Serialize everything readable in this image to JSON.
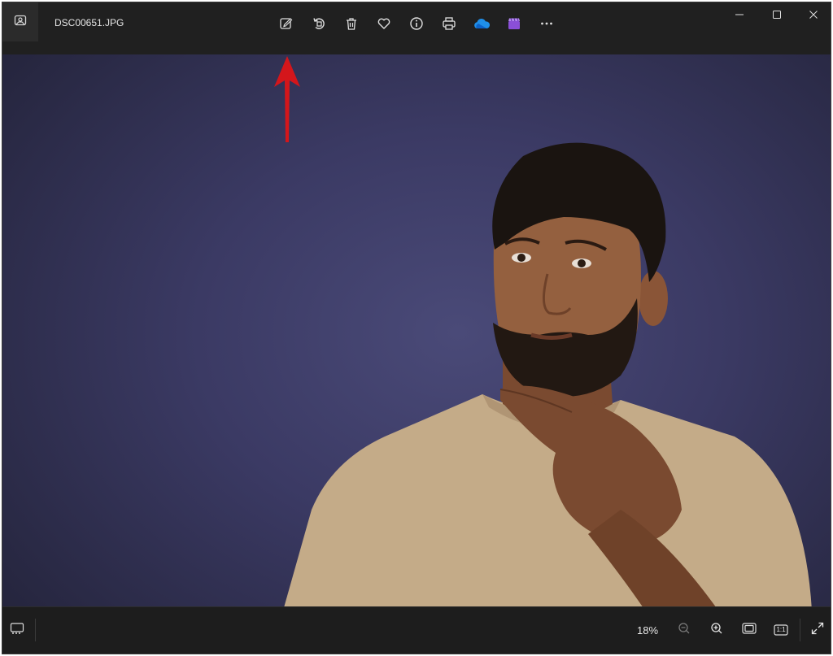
{
  "window": {
    "file_name": "DSC00651.JPG",
    "app_icon": "image-icon"
  },
  "toolbar": {
    "items": [
      {
        "name": "edit-image-button",
        "icon": "edit-image-icon"
      },
      {
        "name": "rotate-button",
        "icon": "rotate-icon"
      },
      {
        "name": "delete-button",
        "icon": "trash-icon"
      },
      {
        "name": "favorite-button",
        "icon": "heart-icon"
      },
      {
        "name": "info-button",
        "icon": "info-icon"
      },
      {
        "name": "print-button",
        "icon": "printer-icon"
      },
      {
        "name": "onedrive-button",
        "icon": "cloud-icon"
      },
      {
        "name": "clipchamp-button",
        "icon": "clapperboard-icon"
      },
      {
        "name": "more-options-button",
        "icon": "ellipsis-icon"
      }
    ]
  },
  "window_controls": [
    "minimize",
    "maximize",
    "close"
  ],
  "status_bar": {
    "zoom_level": "18%",
    "filmstrip_icon": "filmstrip-icon",
    "zoom_out_icon": "zoom-out-icon",
    "zoom_in_icon": "zoom-in-icon",
    "fit_icon": "fit-to-window-icon",
    "actual_size_label": "1:1",
    "fullscreen_icon": "expand-icon"
  },
  "colors": {
    "titlebar": "#202020",
    "background_purple": "#3b3a64",
    "onedrive_blue": "#1f8fe8",
    "clipchamp_purple": "#8a4fd8",
    "annotation_arrow": "#d4161b"
  },
  "photo": {
    "subject": "photo-subject"
  }
}
